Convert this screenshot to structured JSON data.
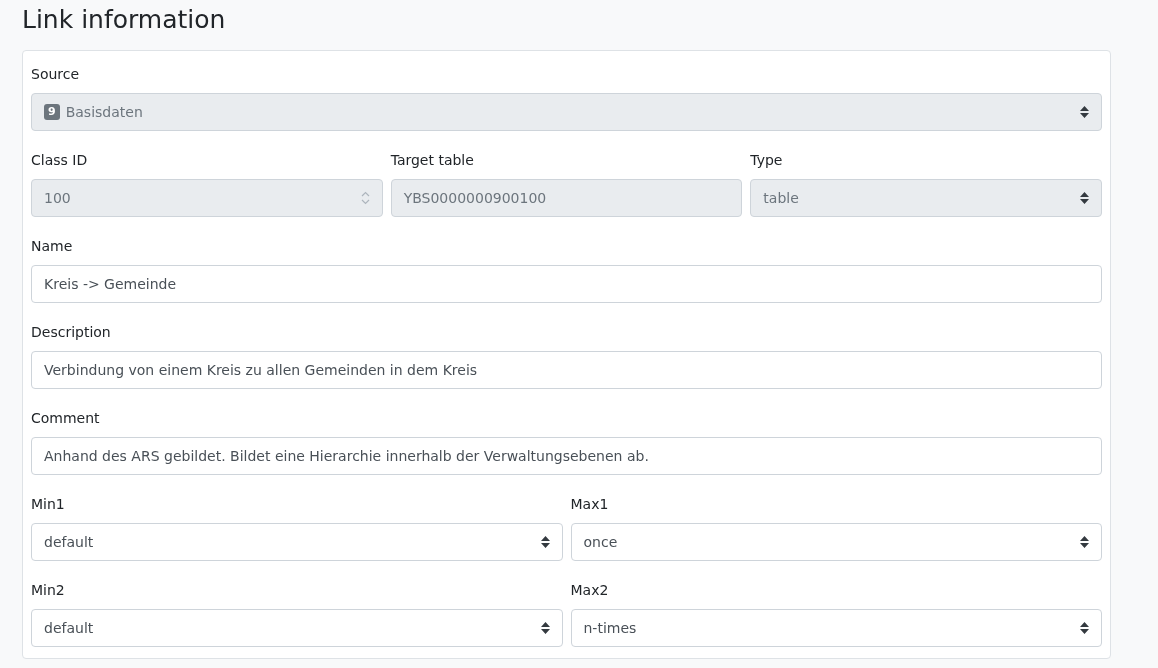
{
  "title": "Link information",
  "rows": [
    {
      "fields": [
        {
          "label": "Source",
          "kind": "select",
          "value": "Basisdaten",
          "badge": "9",
          "disabled": true
        }
      ]
    },
    {
      "fields": [
        {
          "label": "Class ID",
          "kind": "number",
          "value": "100",
          "disabled": true
        },
        {
          "label": "Target table",
          "kind": "text",
          "value": "YBS0000000900100",
          "disabled": true
        },
        {
          "label": "Type",
          "kind": "select",
          "value": "table",
          "disabled": true
        }
      ]
    },
    {
      "fields": [
        {
          "label": "Name",
          "kind": "text",
          "value": "Kreis -> Gemeinde",
          "disabled": false
        }
      ]
    },
    {
      "fields": [
        {
          "label": "Description",
          "kind": "text",
          "value": "Verbindung von einem Kreis zu allen Gemeinden in dem Kreis",
          "disabled": false
        }
      ]
    },
    {
      "fields": [
        {
          "label": "Comment",
          "kind": "text",
          "value": "Anhand des ARS gebildet. Bildet eine Hierarchie innerhalb der Verwaltungsebenen ab.",
          "disabled": false
        }
      ]
    },
    {
      "fields": [
        {
          "label": "Min1",
          "kind": "select",
          "value": "default",
          "disabled": false
        },
        {
          "label": "Max1",
          "kind": "select",
          "value": "once",
          "disabled": false
        }
      ]
    },
    {
      "fields": [
        {
          "label": "Min2",
          "kind": "select",
          "value": "default",
          "disabled": false
        },
        {
          "label": "Max2",
          "kind": "select",
          "value": "n-times",
          "disabled": false
        }
      ]
    }
  ]
}
